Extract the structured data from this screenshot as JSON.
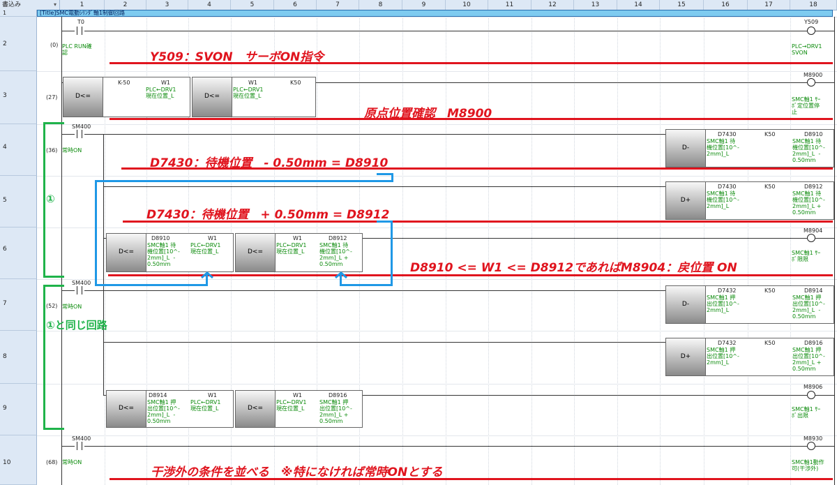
{
  "header": {
    "mode_label": "書込み",
    "columns": [
      "1",
      "2",
      "3",
      "4",
      "5",
      "6",
      "7",
      "8",
      "9",
      "10",
      "11",
      "12",
      "13",
      "14",
      "15",
      "16",
      "17",
      "18"
    ]
  },
  "title_text": "[Title]SMC電動ｼﾘﾝﾀﾞ軸1制御回路",
  "rows": {
    "r1": "1",
    "r2": "2",
    "r3": "3",
    "r4": "4",
    "r5": "5",
    "r6": "6",
    "r7": "7",
    "r8": "8",
    "r9": "9",
    "r10": "10"
  },
  "r2": {
    "step": "(0)",
    "contact": "T0",
    "contact_cmt": "PLC RUN確\n認",
    "coil": "Y509",
    "coil_cmt": "PLC→DRV1\nSVON"
  },
  "r3": {
    "step": "(27)",
    "f1": {
      "op": "D<=",
      "a": "K-50",
      "b": "W1",
      "b_cmt": "PLC←DRV1\n現在位置_L"
    },
    "f2": {
      "op": "D<=",
      "a": "W1",
      "a_cmt": "PLC←DRV1\n現在位置_L",
      "b": "K50"
    },
    "coil": "M8900",
    "coil_cmt": "SMC軸1 ｻｰ\nﾎﾞ定位置停\n止"
  },
  "r4": {
    "step": "(36)",
    "contact": "SM400",
    "contact_cmt": "常時ON",
    "f": {
      "op": "D-",
      "a": "D7430",
      "a_cmt": "SMC軸1 待\n機位置[10^-\n2mm]_L",
      "b": "K50",
      "c": "D8910",
      "c_cmt": "SMC軸1 待\n機位置[10^-\n2mm]_L  -\n0.50mm"
    }
  },
  "r5": {
    "f": {
      "op": "D+",
      "a": "D7430",
      "a_cmt": "SMC軸1 待\n機位置[10^-\n2mm]_L",
      "b": "K50",
      "c": "D8912",
      "c_cmt": "SMC軸1 待\n機位置[10^-\n2mm]_L +\n0.50mm"
    }
  },
  "r6": {
    "f1": {
      "op": "D<=",
      "a": "D8910",
      "a_cmt": "SMC軸1 待\n機位置[10^-\n2mm]_L  -\n0.50mm",
      "b": "W1",
      "b_cmt": "PLC←DRV1\n現在位置_L"
    },
    "f2": {
      "op": "D<=",
      "a": "W1",
      "a_cmt": "PLC←DRV1\n現在位置_L",
      "b": "D8912",
      "b_cmt": "SMC軸1 待\n機位置[10^-\n2mm]_L +\n0.50mm"
    },
    "coil": "M8904",
    "coil_cmt": "SMC軸1 ｻｰ\nﾎﾞ限限"
  },
  "r7": {
    "step": "(52)",
    "contact": "SM400",
    "contact_cmt": "常時ON",
    "f": {
      "op": "D-",
      "a": "D7432",
      "a_cmt": "SMC軸1 押\n出位置[10^-\n2mm]_L",
      "b": "K50",
      "c": "D8914",
      "c_cmt": "SMC軸1 押\n出位置[10^-\n2mm]_L  -\n0.50mm"
    }
  },
  "r8": {
    "f": {
      "op": "D+",
      "a": "D7432",
      "a_cmt": "SMC軸1 押\n出位置[10^-\n2mm]_L",
      "b": "K50",
      "c": "D8916",
      "c_cmt": "SMC軸1 押\n出位置[10^-\n2mm]_L +\n0.50mm"
    }
  },
  "r9": {
    "f1": {
      "op": "D<=",
      "a": "D8914",
      "a_cmt": "SMC軸1 押\n出位置[10^-\n2mm]_L  -\n0.50mm",
      "b": "W1",
      "b_cmt": "PLC←DRV1\n現在位置_L"
    },
    "f2": {
      "op": "D<=",
      "a": "W1",
      "a_cmt": "PLC←DRV1\n現在位置_L",
      "b": "D8916",
      "b_cmt": "SMC軸1 押\n出位置[10^-\n2mm]_L +\n0.50mm"
    },
    "coil": "M8906",
    "coil_cmt": "SMC軸1 ｻｰ\nﾎﾞ出限"
  },
  "r10": {
    "step": "(68)",
    "contact": "SM400",
    "contact_cmt": "常時ON",
    "coil": "M8930",
    "coil_cmt": "SMC軸1動作\n可(干渉外)"
  },
  "annotations": {
    "a1": "Y509：SVON　サーボON指令",
    "a2": "原点位置確認　M8900",
    "a3": "D7430：待機位置　- 0.50mm = D8910",
    "a4": "D7430：待機位置　+ 0.50mm = D8912",
    "a5": "D8910 <= W1 <= D8912であればM8904：戻位置 ON",
    "a6": "干渉外の条件を並べる　※特になければ常時ONとする",
    "g1": "①",
    "g2": "①と同じ回路"
  },
  "colors": {
    "red": "#e0141e",
    "green": "#1fb34a",
    "blue": "#1f98e6"
  }
}
